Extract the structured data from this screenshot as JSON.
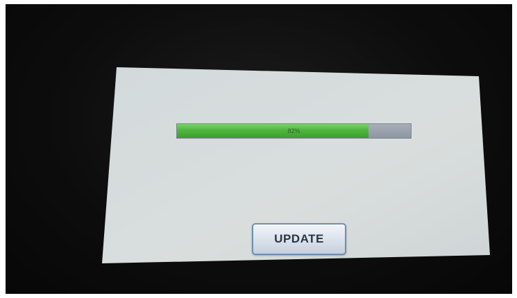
{
  "progress": {
    "percent": 82,
    "label": "82%"
  },
  "update_button": {
    "label": "UPDATE"
  },
  "colors": {
    "screen_background": "#d4d9da",
    "progress_fill": "#4fb53f",
    "progress_track": "#9aa1ac",
    "button_border": "#6f8fb3",
    "bezel": "#0d0d0d"
  }
}
